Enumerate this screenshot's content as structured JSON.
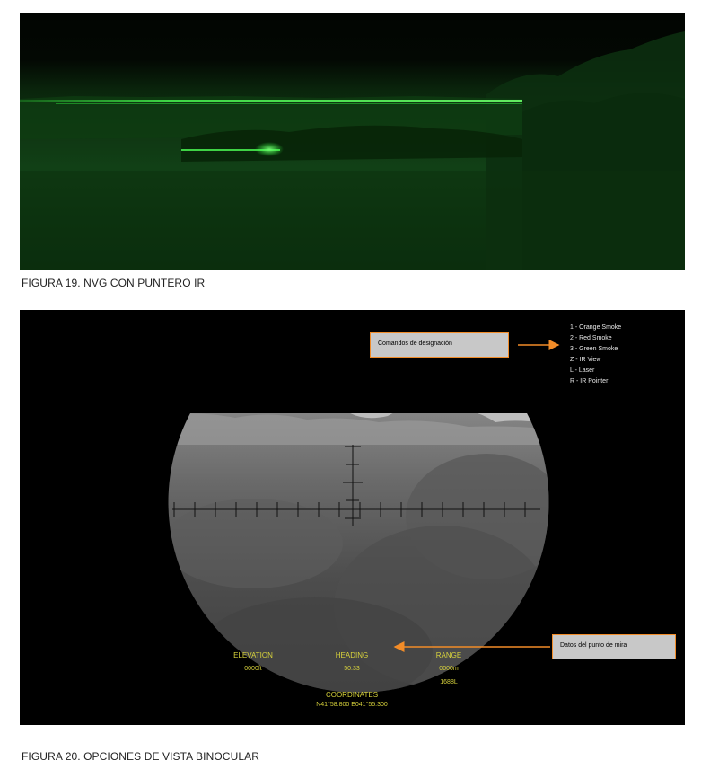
{
  "figure19": {
    "caption": "FIGURA 19. NVG CON PUNTERO IR"
  },
  "figure20": {
    "caption": "FIGURA 20. OPCIONES DE VISTA BINOCULAR",
    "callouts": {
      "designation": "Comandos de designación",
      "aim_point": "Datos del punto de mira"
    },
    "menu": [
      "1 - Orange Smoke",
      "2 - Red Smoke",
      "3 - Green Smoke",
      "Z - IR View",
      "L - Laser",
      "R - IR Pointer"
    ],
    "hud": {
      "elevation_label": "ELEVATION",
      "elevation_value": "0000ft",
      "heading_label": "HEADING",
      "heading_value": "50.33",
      "range_label": "RANGE",
      "range_value": "0000m",
      "range_mode": "1688L",
      "coordinates_label": "COORDINATES",
      "coordinates_value": "N41°58.800 E041°55.300"
    }
  },
  "colors": {
    "nvg_green": "#39ff4a",
    "hud_yellow": "#d8d33c",
    "callout_border": "#f28c28",
    "callout_fill": "#c8c8c8"
  }
}
